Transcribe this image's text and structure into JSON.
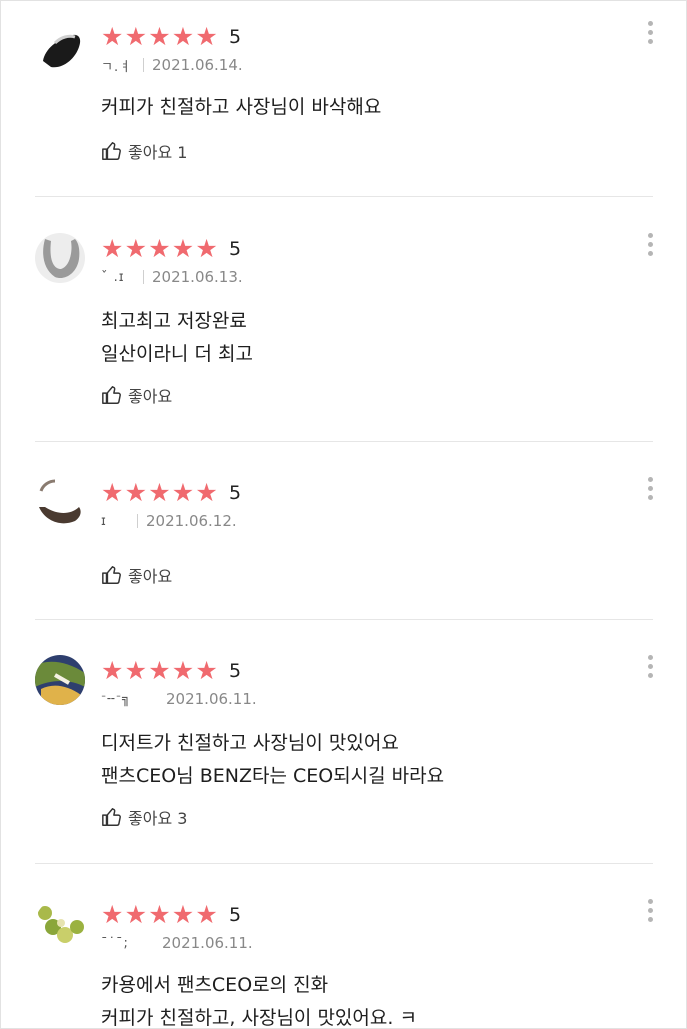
{
  "colors": {
    "star": "#f06a6f",
    "divider": "#e6e6e6"
  },
  "reviews": [
    {
      "rating": "5",
      "name": "ㄱ.ㅕ",
      "date": "2021.06.14.",
      "lines": [
        "커피가 친절하고 사장님이 바삭해요"
      ],
      "like_label": "좋아요 1",
      "avatar_icon": "profile-photo"
    },
    {
      "rating": "5",
      "name": "ˇ .ɪ",
      "date": "2021.06.13.",
      "lines": [
        "최고최고 저장완료",
        "일산이라니 더 최고"
      ],
      "like_label": "좋아요",
      "avatar_icon": "profile-photo"
    },
    {
      "rating": "5",
      "name": "ɪ",
      "date": "2021.06.12.",
      "lines": [],
      "like_label": "좋아요",
      "avatar_icon": "profile-photo"
    },
    {
      "rating": "5",
      "name": "ᐨ╌ᐨ╗",
      "date": "2021.06.11.",
      "lines": [
        "디저트가 친절하고 사장님이 맛있어요",
        "팬츠CEO님 BENZ타는 CEO되시길 바라요"
      ],
      "like_label": "좋아요 3",
      "avatar_icon": "profile-photo"
    },
    {
      "rating": "5",
      "name": "ˉ˙ˉ;",
      "date": "2021.06.11.",
      "lines": [
        "카용에서 팬츠CEO로의 진화",
        "커피가 친절하고, 사장님이 맛있어요. ㅋ"
      ],
      "like_label": "",
      "avatar_icon": "profile-photo"
    }
  ]
}
